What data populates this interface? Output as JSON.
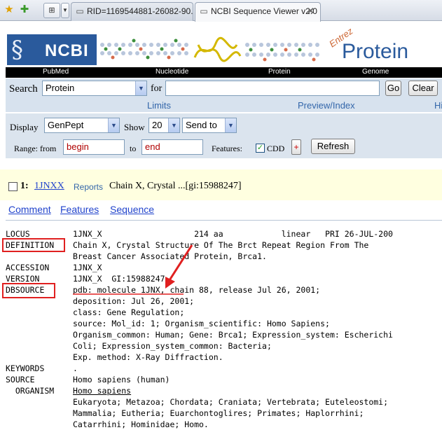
{
  "browser": {
    "tab1_label": "RID=1169544881-26082-90...",
    "tab2_label": "NCBI Sequence Viewer v2.0"
  },
  "banner": {
    "logo_text": "NCBI",
    "entrez_text": "Entrez",
    "db_title": "Protein"
  },
  "nav": [
    "PubMed",
    "Nucleotide",
    "Protein",
    "Genome"
  ],
  "search": {
    "search_label": "Search",
    "db_value": "Protein",
    "for_label": "for",
    "query_value": "",
    "go_label": "Go",
    "clear_label": "Clear"
  },
  "limits": [
    "Limits",
    "Preview/Index",
    "Hi"
  ],
  "display": {
    "display_label": "Display",
    "format_value": "GenPept",
    "show_label": "Show",
    "show_value": "20",
    "sendto_value": "Send to",
    "range_label": "Range: from",
    "from_placeholder": "begin",
    "to_label": "to",
    "to_placeholder": "end",
    "features_label": "Features:",
    "cdd_label": "CDD",
    "plus_label": "+",
    "refresh_label": "Refresh"
  },
  "result": {
    "number": "1:",
    "accession": "1JNXX",
    "reports": "Reports",
    "title": "Chain X, Crystal ...[gi:15988247]"
  },
  "links": [
    "Comment",
    "Features",
    "Sequence"
  ],
  "record": {
    "locus_key": "LOCUS",
    "locus_line": "1JNX_X                   214 aa            linear   PRI 26-JUL-200",
    "definition_key": "DEFINITION",
    "definition_lines": [
      "Chain X, Crystal Structure Of The Brct Repeat Region From The",
      "Breast Cancer Associated Protein, Brca1."
    ],
    "accession_key": "ACCESSION",
    "accession_line": "1JNX_X",
    "version_key": "VERSION",
    "version_line": "1JNX_X  GI:15988247",
    "dbsource_key": "DBSOURCE",
    "dbsource_lines": [
      "pdb: molecule 1JNX, chain 88, release Jul 26, 2001;",
      "deposition: Jul 26, 2001;",
      "class: Gene Regulation;",
      "source: Mol_id: 1; Organism_scientific: Homo Sapiens;",
      "Organism_common: Human; Gene: Brca1; Expression_system: Escherichi",
      "Coli; Expression_system_common: Bacteria;",
      "Exp. method: X-Ray Diffraction."
    ],
    "keywords_key": "KEYWORDS",
    "keywords_line": ".",
    "source_key": "SOURCE",
    "source_line": "Homo sapiens (human)",
    "organism_key": "  ORGANISM",
    "organism_name": "Homo sapiens",
    "lineage_lines": [
      "Eukaryota; Metazoa; Chordata; Craniata; Vertebrata; Euteleostomi;",
      "Mammalia; Eutheria; Euarchontoglires; Primates; Haplorrhini;",
      "Catarrhini; Hominidae; Homo."
    ]
  },
  "colors": {
    "ncbi_blue": "#2a5a9c",
    "highlight_red": "#e02020",
    "link_blue": "#2244cc",
    "result_bg": "#ffffe0"
  }
}
